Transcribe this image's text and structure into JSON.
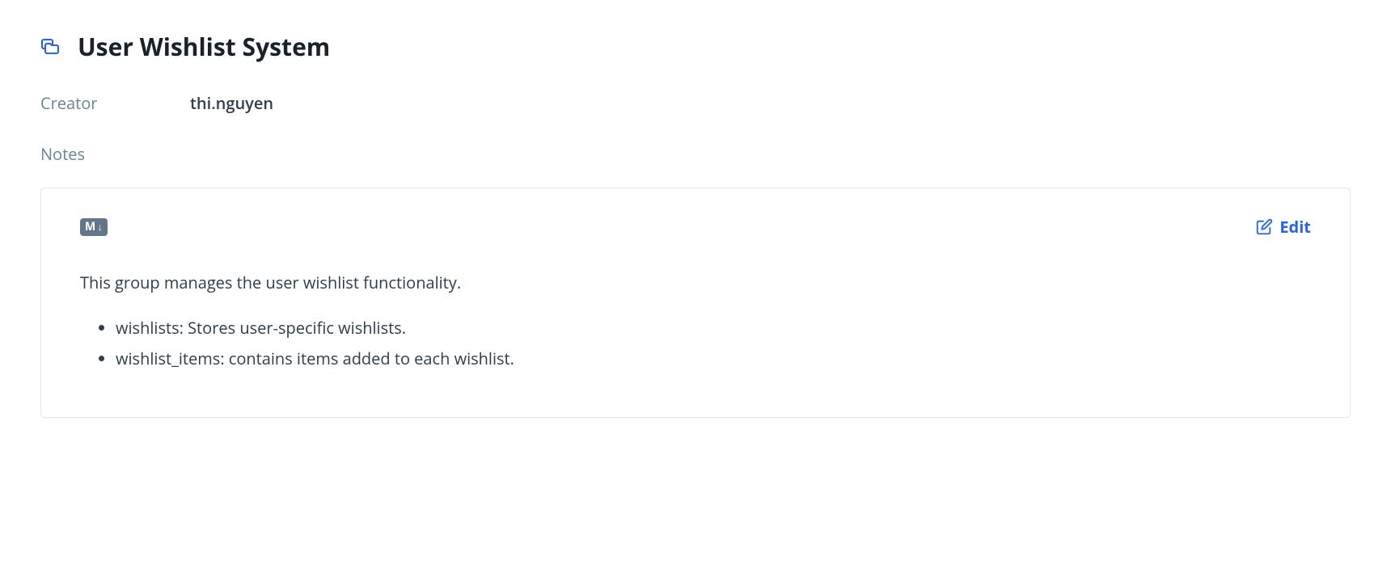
{
  "header": {
    "title": "User Wishlist System"
  },
  "meta": {
    "creator_label": "Creator",
    "creator_value": "thi.nguyen"
  },
  "notes": {
    "label": "Notes",
    "md_badge_text": "M",
    "edit_label": "Edit",
    "body_paragraph": "This group manages the user wishlist functionality.",
    "body_items": [
      "wishlists: Stores user-specific wishlists.",
      "wishlist_items: contains items added to each wishlist."
    ]
  }
}
